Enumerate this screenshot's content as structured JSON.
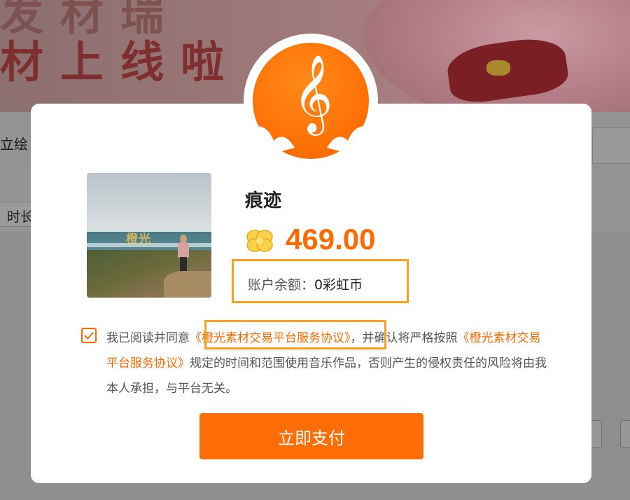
{
  "background": {
    "banner_line1": "发材瑞",
    "banner_line2": "材上线啦",
    "tab_label": "立绘",
    "filter_label": "时长"
  },
  "modal": {
    "track_title": "痕迹",
    "price": "469.00",
    "balance_label": "账户余额：",
    "balance_value": "0彩虹币",
    "cover_watermark": "橙光",
    "agreement": {
      "text_before": "我已阅读并同意",
      "link1": "《橙光素材交易平台服务协议》",
      "text_middle": "，并确认将严格按照",
      "link2": "《橙光素材交易平台服务协议》",
      "text_after": "规定的时间和范围使用音乐作品，否则产生的侵权责任的风险将由我本人承担，与平台无关。",
      "checked": true
    },
    "pay_button_label": "立即支付"
  },
  "colors": {
    "accent": "#ff6a00",
    "highlight_border": "#f6a21e",
    "overlay": "#8d8d8d"
  },
  "icons": [
    "music-note-icon",
    "clover-coin-icon",
    "checkmark-icon"
  ]
}
